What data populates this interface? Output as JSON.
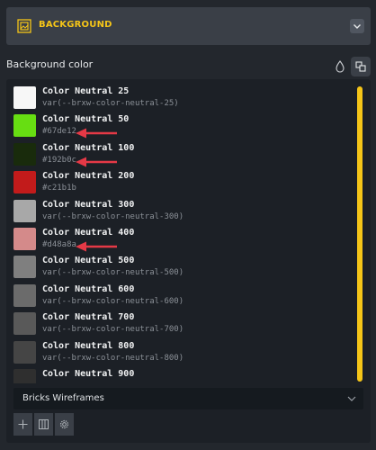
{
  "header": {
    "title": "BACKGROUND",
    "icon": "image-frame-icon",
    "toggle_icon": "chevron-down-icon"
  },
  "background_color": {
    "label": "Background color"
  },
  "toolbar_icons": {
    "drop": "drop-icon",
    "variables": "variables-icon"
  },
  "colors": [
    {
      "name": "Color Neutral 25",
      "value": "var(--brxw-color-neutral-25)",
      "swatch": "#f7f7f7"
    },
    {
      "name": "Color Neutral 50",
      "value": "#67de12",
      "swatch": "#67de12"
    },
    {
      "name": "Color Neutral 100",
      "value": "#192b0c",
      "swatch": "#192b0c"
    },
    {
      "name": "Color Neutral 200",
      "value": "#c21b1b",
      "swatch": "#c21b1b"
    },
    {
      "name": "Color Neutral 300",
      "value": "var(--brxw-color-neutral-300)",
      "swatch": "#a8a8a8"
    },
    {
      "name": "Color Neutral 400",
      "value": "#d48a8a",
      "swatch": "#d48a8a"
    },
    {
      "name": "Color Neutral 500",
      "value": "var(--brxw-color-neutral-500)",
      "swatch": "#7f7f7f"
    },
    {
      "name": "Color Neutral 600",
      "value": "var(--brxw-color-neutral-600)",
      "swatch": "#6b6b6b"
    },
    {
      "name": "Color Neutral 700",
      "value": "var(--brxw-color-neutral-700)",
      "swatch": "#595959"
    },
    {
      "name": "Color Neutral 800",
      "value": "var(--brxw-color-neutral-800)",
      "swatch": "#454545"
    },
    {
      "name": "Color Neutral 900",
      "value": "",
      "swatch": "#2f2f2f"
    }
  ],
  "palette_select": {
    "value": "Bricks Wireframes"
  },
  "bottom_tools": [
    "add-icon",
    "grid-view-icon",
    "gear-icon"
  ],
  "accent": "#f5c518",
  "annotation_color": "#e53946"
}
